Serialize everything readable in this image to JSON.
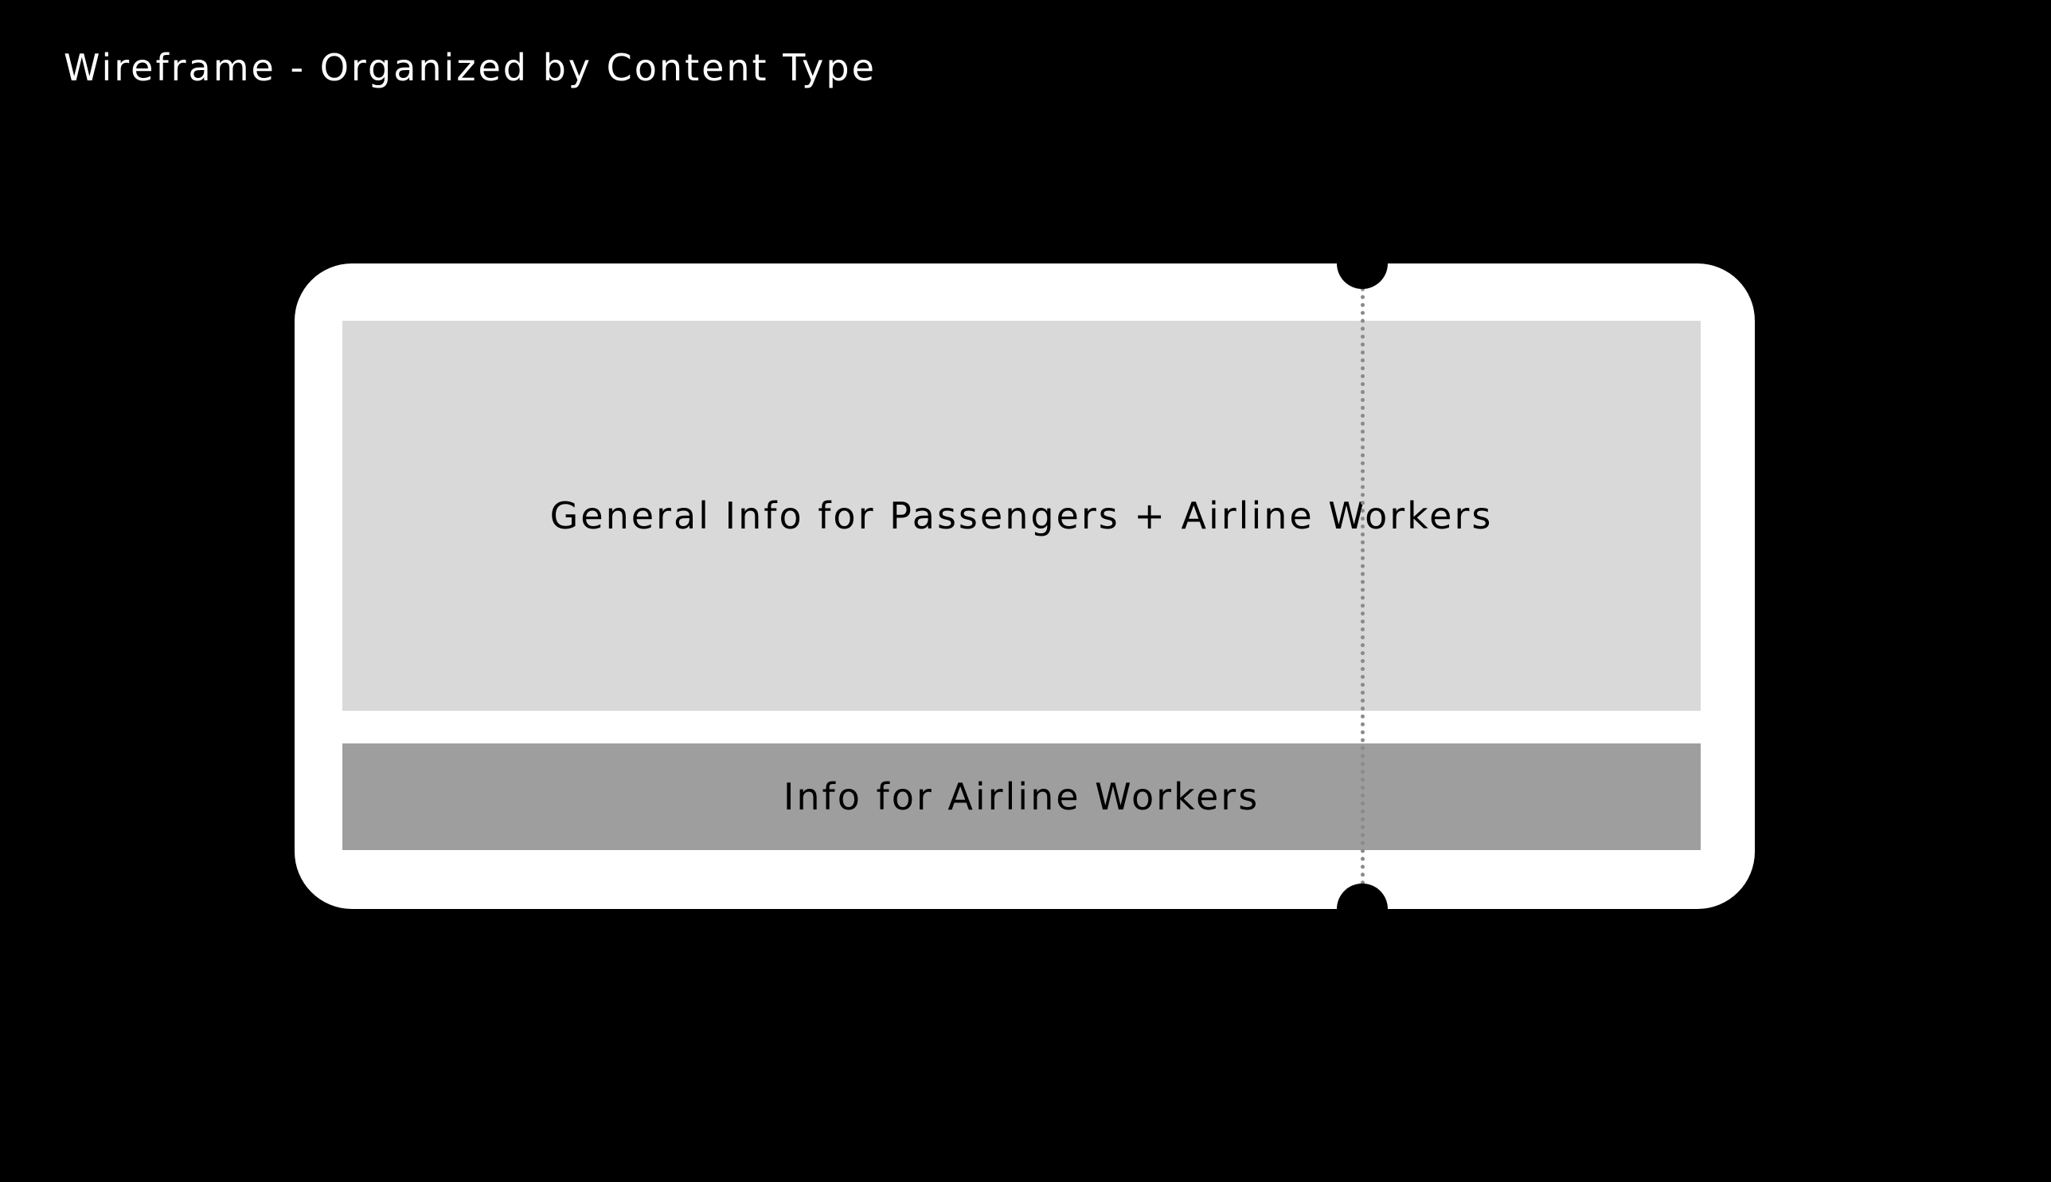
{
  "page": {
    "title": "Wireframe - Organized by Content Type"
  },
  "ticket": {
    "sections": [
      {
        "label": "General Info for Passengers + Airline Workers",
        "fill": "#d9d9d9"
      },
      {
        "label": "Info for Airline Workers",
        "fill": "#9e9e9e"
      }
    ],
    "colors": {
      "background": "#000000",
      "ticket": "#ffffff",
      "perforation": "#8a8a8a"
    }
  }
}
